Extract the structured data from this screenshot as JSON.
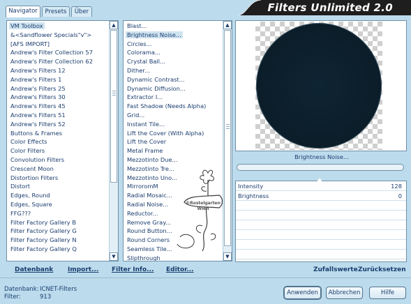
{
  "app": {
    "title": "Filters Unlimited 2.0"
  },
  "tabs": [
    {
      "label": "Navigator",
      "active": true
    },
    {
      "label": "Presets",
      "active": false
    },
    {
      "label": "Über",
      "active": false
    }
  ],
  "categories": {
    "selected": "VM Toolbox",
    "items": [
      "VM Toolbox",
      "&<Sandflower Specials\"v\">",
      "[AFS IMPORT]",
      "Andrew's Filter Collection 57",
      "Andrew's Filter Collection 62",
      "Andrew's Filters 12",
      "Andrew's Filters 1",
      "Andrew's Filters 25",
      "Andrew's Filters 30",
      "Andrew's Filters 45",
      "Andrew's Filters 51",
      "Andrew's Filters 52",
      "Buttons & Frames",
      "Color Effects",
      "Color Filters",
      "Convolution Filters",
      "Crescent Moon",
      "Distortion Filters",
      "Distort",
      "Edges, Round",
      "Edges, Square",
      "FFG???",
      "Filter Factory Gallery B",
      "Filter Factory Gallery G",
      "Filter Factory Gallery N",
      "Filter Factory Gallery Q"
    ]
  },
  "filters": {
    "selected": "Brightness Noise...",
    "items": [
      "Blast...",
      "Brightness Noise...",
      "Circles...",
      "Colorama...",
      "Crystal Ball...",
      "Dither...",
      "Dynamic Contrast...",
      "Dynamic Diffusion...",
      "Extractor I...",
      "Fast Shadow (Needs Alpha)",
      "Grid...",
      "Instant Tile...",
      "Lift the Cover (With Alpha)",
      "Lift the Cover",
      "Metal Frame",
      "Mezzotinto Due...",
      "Mezzotinto Tre...",
      "Mezzotinto Uno...",
      "MirroromM",
      "Radial Mosaic...",
      "Radial Noise...",
      "Reductor...",
      "Remove Gray...",
      "Round Button...",
      "Round Corners",
      "Seamless Tile...",
      "Slipthrough"
    ]
  },
  "preview": {
    "filter_name": "Brightness Noise..."
  },
  "params": [
    {
      "label": "Intensity",
      "value": "128"
    },
    {
      "label": "Brightness",
      "value": "0"
    }
  ],
  "watermark": {
    "line1": "©Rostelgarten",
    "line2": "Wien"
  },
  "commands": {
    "datenbank": "Datenbank",
    "import": "Import...",
    "filter_info": "Filter Info...",
    "editor": "Editor...",
    "zufallswerte": "Zufallswerte",
    "zuruecksetzen": "Zurücksetzen"
  },
  "info": {
    "datenbank_label": "Datenbank:",
    "datenbank_value": "ICNET-Filters",
    "filter_label": "Filter:",
    "filter_value": "913"
  },
  "buttons": {
    "apply": "Anwenden",
    "cancel": "Abbrechen",
    "help": "Hilfe"
  },
  "colors": {
    "background": "#bcdced",
    "banner": "#1e1e1e",
    "text": "#1a3c6e",
    "selection": "#cfe3f0"
  }
}
